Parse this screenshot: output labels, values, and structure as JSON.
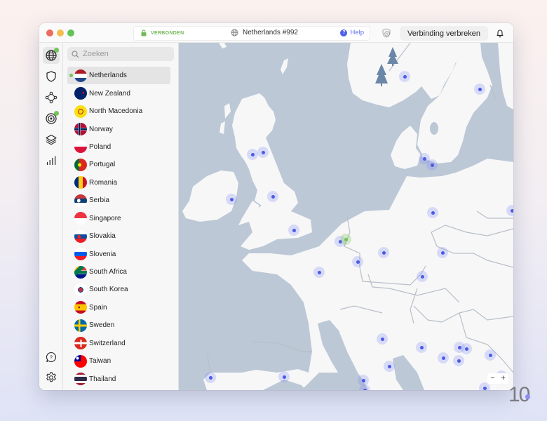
{
  "window": {
    "status_label": "VERBONDEN",
    "server_name": "Netherlands #992",
    "help_label": "Help",
    "disconnect_label": "Verbinding verbreken"
  },
  "rail": {
    "items": [
      {
        "name": "globe",
        "active": true,
        "badge": true
      },
      {
        "name": "shield",
        "active": false,
        "badge": false
      },
      {
        "name": "meshnet",
        "active": false,
        "badge": false
      },
      {
        "name": "target",
        "active": false,
        "badge": true
      },
      {
        "name": "layers",
        "active": false,
        "badge": false
      },
      {
        "name": "stats",
        "active": false,
        "badge": false
      }
    ],
    "bottom": [
      "help",
      "settings"
    ]
  },
  "search": {
    "placeholder": "Zoeken",
    "value": ""
  },
  "countries": [
    {
      "name": "Netherlands",
      "selected": true,
      "connected": true
    },
    {
      "name": "New Zealand"
    },
    {
      "name": "North Macedonia"
    },
    {
      "name": "Norway"
    },
    {
      "name": "Poland"
    },
    {
      "name": "Portugal"
    },
    {
      "name": "Romania"
    },
    {
      "name": "Serbia"
    },
    {
      "name": "Singapore"
    },
    {
      "name": "Slovakia"
    },
    {
      "name": "Slovenia"
    },
    {
      "name": "South Africa"
    },
    {
      "name": "South Korea"
    },
    {
      "name": "Spain"
    },
    {
      "name": "Sweden"
    },
    {
      "name": "Switzerland"
    },
    {
      "name": "Taiwan"
    },
    {
      "name": "Thailand"
    }
  ],
  "map": {
    "zoom_out_label": "−",
    "zoom_in_label": "+",
    "colors": {
      "sea": "#bcc8d6",
      "land": "#f7f7f8",
      "pin": "#4c5ae6",
      "connected": "#74c257"
    }
  },
  "brand": {
    "logo_text": "10"
  },
  "colors": {
    "accent": "#4a5ee8",
    "connected": "#72b857"
  }
}
